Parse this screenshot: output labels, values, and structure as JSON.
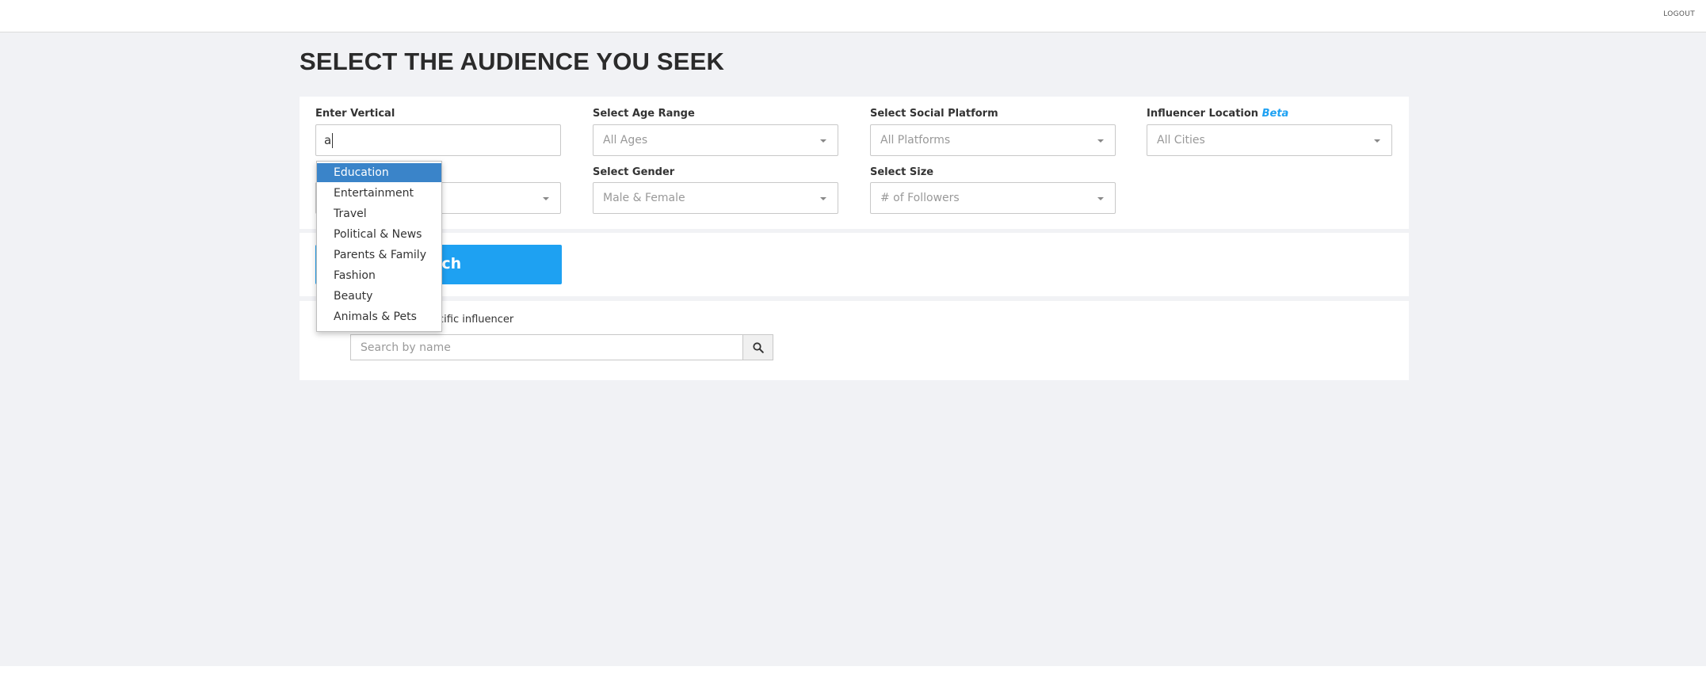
{
  "header": {
    "logout_label": "LOGOUT"
  },
  "page": {
    "title": "SELECT THE AUDIENCE YOU SEEK"
  },
  "filters": {
    "vertical": {
      "label": "Enter Vertical",
      "value": "a"
    },
    "age": {
      "label": "Select Age Range",
      "value": "All Ages"
    },
    "platform": {
      "label": "Select Social Platform",
      "value": "All Platforms"
    },
    "location": {
      "label": "Influencer Location",
      "beta": "Beta",
      "value": "All Cities"
    },
    "gender": {
      "label": "Select Gender",
      "value": "Male & Female"
    },
    "size": {
      "label": "Select Size",
      "value": "# of Followers"
    }
  },
  "search_button": {
    "label": "rch"
  },
  "name_search": {
    "label": "ecific influencer",
    "placeholder": "Search by name"
  },
  "autocomplete": {
    "active_index": 0,
    "options": [
      "Education",
      "Entertainment",
      "Travel",
      "Political & News",
      "Parents & Family",
      "Fashion",
      "Beauty",
      "Animals & Pets"
    ]
  },
  "colors": {
    "accent": "#1ea1f2",
    "highlight": "#3a84c9",
    "background": "#f1f2f5"
  }
}
